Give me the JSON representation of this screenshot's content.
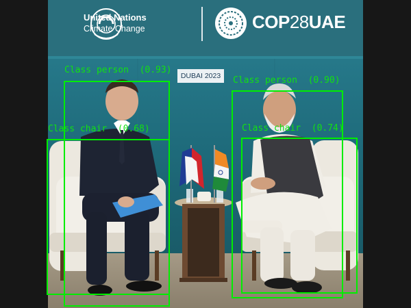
{
  "banner": {
    "un_line1": "United Nations",
    "un_line2": "Climate Change",
    "cop_main": "COP",
    "cop_num": "28",
    "cop_tail": "UAE"
  },
  "sign": {
    "text": "DUBAI 2023"
  },
  "detections": [
    {
      "label": "Class person  (0.93)"
    },
    {
      "label": "Class person  (0.90)"
    },
    {
      "label": "Class chair  (0.68)"
    },
    {
      "label": "Class chair  (0.74)"
    }
  ],
  "colors": {
    "bbox": "#00ee00",
    "backdrop": "#1d7a8e"
  }
}
